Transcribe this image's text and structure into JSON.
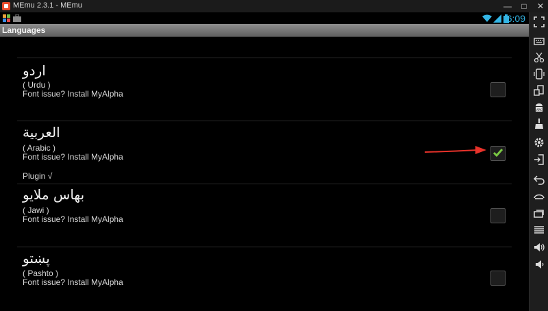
{
  "window": {
    "title": "MEmu 2.3.1 - MEmu"
  },
  "statusbar": {
    "time": "6:09"
  },
  "actionbar": {
    "title": "Languages"
  },
  "languages": [
    {
      "native": "اردو",
      "english": "( Urdu )",
      "font_note": "Font issue? Install MyAlpha",
      "checked": false
    },
    {
      "native": "العربية",
      "english": "( Arabic )",
      "font_note": "Font issue? Install MyAlpha",
      "plugin": "Plugin √",
      "checked": true
    },
    {
      "native": "بهاس ملايو",
      "english": "( Jawi )",
      "font_note": "Font issue? Install MyAlpha",
      "checked": false
    },
    {
      "native": "پښتو",
      "english": "( Pashto )",
      "font_note": "Font issue? Install MyAlpha",
      "checked": false
    }
  ],
  "sidebar_tools": [
    "fullscreen-icon",
    "keyboard-icon",
    "screenshot-scissors-icon",
    "shake-icon",
    "rotate-icon",
    "apk-install-icon",
    "clean-broom-icon",
    "settings-gear-icon",
    "import-file-icon",
    "back-icon",
    "home-icon",
    "recent-apps-icon",
    "menu-icon",
    "volume-up-icon",
    "volume-down-icon"
  ],
  "colors": {
    "accent": "#33b5e5",
    "check": "#7ac943",
    "arrow": "#e8322a"
  }
}
